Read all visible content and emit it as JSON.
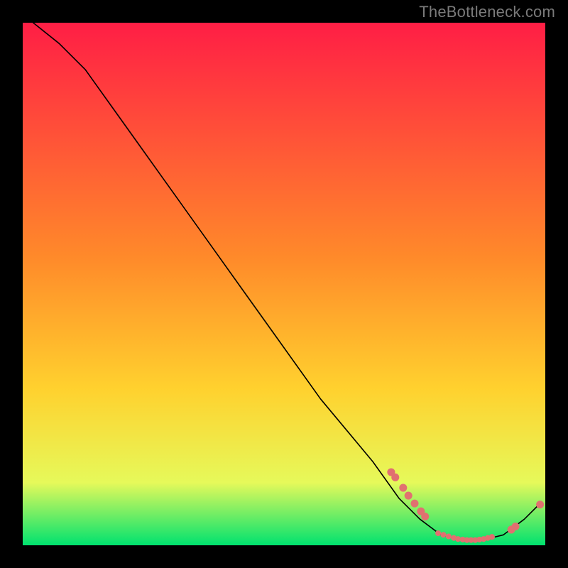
{
  "watermark": "TheBottleneck.com",
  "annotation": {
    "text": ""
  },
  "chart_data": {
    "type": "line",
    "title": "",
    "xlabel": "",
    "ylabel": "",
    "xlim": [
      0,
      100
    ],
    "ylim": [
      0,
      100
    ],
    "grid": false,
    "legend": false,
    "background_gradient": {
      "top_color": "#ff1e45",
      "mid_color": "#ffd12e",
      "low_color": "#e6f95a",
      "bottom_color": "#00e26f"
    },
    "line_color": "#000000",
    "marker_color": "#e17070",
    "curve": [
      {
        "x": 2,
        "y": 100
      },
      {
        "x": 7,
        "y": 96
      },
      {
        "x": 12,
        "y": 91
      },
      {
        "x": 17,
        "y": 84
      },
      {
        "x": 22,
        "y": 77
      },
      {
        "x": 27,
        "y": 70
      },
      {
        "x": 32,
        "y": 63
      },
      {
        "x": 37,
        "y": 56
      },
      {
        "x": 42,
        "y": 49
      },
      {
        "x": 47,
        "y": 42
      },
      {
        "x": 52,
        "y": 35
      },
      {
        "x": 57,
        "y": 28
      },
      {
        "x": 62,
        "y": 22
      },
      {
        "x": 67,
        "y": 16
      },
      {
        "x": 72,
        "y": 9
      },
      {
        "x": 76,
        "y": 5
      },
      {
        "x": 80,
        "y": 2
      },
      {
        "x": 84,
        "y": 1
      },
      {
        "x": 88,
        "y": 1
      },
      {
        "x": 92,
        "y": 2
      },
      {
        "x": 96,
        "y": 5
      },
      {
        "x": 99,
        "y": 8
      }
    ],
    "markers_upper_cluster": [
      {
        "x": 70.5,
        "y": 14
      },
      {
        "x": 71.3,
        "y": 13
      },
      {
        "x": 72.8,
        "y": 11
      },
      {
        "x": 73.8,
        "y": 9.5
      },
      {
        "x": 75.0,
        "y": 8
      },
      {
        "x": 76.2,
        "y": 6.5
      },
      {
        "x": 77.0,
        "y": 5.5
      }
    ],
    "markers_flat_cluster": [
      {
        "x": 79.5,
        "y": 2.3
      },
      {
        "x": 80.5,
        "y": 2.0
      },
      {
        "x": 81.5,
        "y": 1.7
      },
      {
        "x": 82.5,
        "y": 1.4
      },
      {
        "x": 83.3,
        "y": 1.2
      },
      {
        "x": 84.2,
        "y": 1.1
      },
      {
        "x": 85.0,
        "y": 1.0
      },
      {
        "x": 85.8,
        "y": 1.0
      },
      {
        "x": 86.6,
        "y": 1.0
      },
      {
        "x": 87.4,
        "y": 1.1
      },
      {
        "x": 88.2,
        "y": 1.2
      },
      {
        "x": 89.0,
        "y": 1.4
      },
      {
        "x": 89.8,
        "y": 1.6
      }
    ],
    "markers_tail": [
      {
        "x": 93.5,
        "y": 3.0
      },
      {
        "x": 94.3,
        "y": 3.6
      },
      {
        "x": 99.0,
        "y": 7.8
      }
    ],
    "annotation_near_markers": ""
  }
}
